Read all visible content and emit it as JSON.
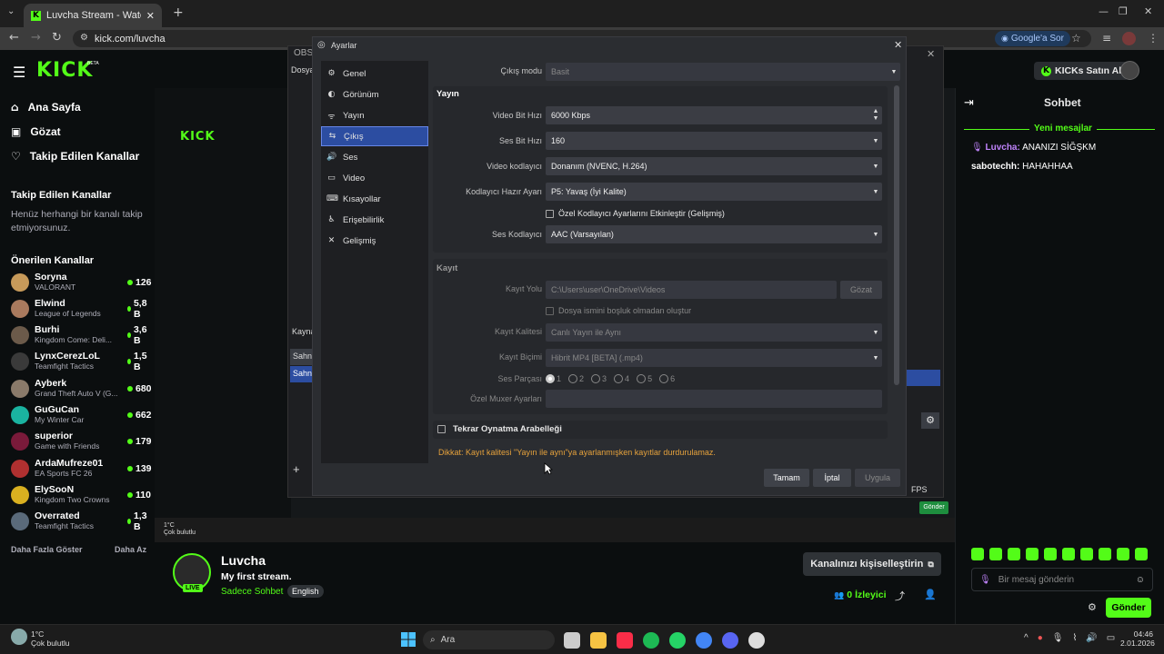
{
  "browser": {
    "tab_title": "Luvcha Stream - Watch Live",
    "url": "kick.com/luvcha",
    "google_button": "Google'a Sor"
  },
  "site": {
    "nav": [
      {
        "label": "Ana Sayfa",
        "icon": "home-icon"
      },
      {
        "label": "Gözat",
        "icon": "browse-icon"
      },
      {
        "label": "Takip Edilen Kanallar",
        "icon": "heart-icon"
      }
    ],
    "followed_heading": "Takip Edilen Kanallar",
    "followed_empty": "Henüz herhangi bir kanalı takip etmiyorsunuz.",
    "suggested_heading": "Önerilen Kanallar",
    "channels": [
      {
        "name": "Soryna",
        "game": "VALORANT",
        "viewers": "126",
        "color": "#c79a5a"
      },
      {
        "name": "Elwind",
        "game": "League of Legends",
        "viewers": "5,8 B",
        "color": "#a97a5e"
      },
      {
        "name": "Burhi",
        "game": "Kingdom Come: Deli...",
        "viewers": "3,6 B",
        "color": "#6b5a4a"
      },
      {
        "name": "LynxCerezLoL",
        "game": "Teamfight Tactics",
        "viewers": "1,5 B",
        "color": "#3a3a3a"
      },
      {
        "name": "Ayberk",
        "game": "Grand Theft Auto V (G...",
        "viewers": "680",
        "color": "#8a7a6a"
      },
      {
        "name": "GuGuCan",
        "game": "My Winter Car",
        "viewers": "662",
        "color": "#1ab3a0"
      },
      {
        "name": "superior",
        "game": "Game with Friends",
        "viewers": "179",
        "color": "#7a1a3a"
      },
      {
        "name": "ArdaMufreze01",
        "game": "EA Sports FC 26",
        "viewers": "139",
        "color": "#b03030"
      },
      {
        "name": "ElySooN",
        "game": "Kingdom Two Crowns",
        "viewers": "110",
        "color": "#d9b020"
      },
      {
        "name": "Overrated",
        "game": "Teamfight Tactics",
        "viewers": "1,3 B",
        "color": "#5a6a7a"
      }
    ],
    "show_more": "Daha Fazla Göster",
    "show_less": "Daha Az",
    "buy_kicks": "KICKs Satın Al",
    "streamer": {
      "name": "Luvcha",
      "title": "My first stream.",
      "category": "Sadece Sohbet",
      "language": "English",
      "live_badge": "LIVE",
      "customize_button": "Kanalınızı kişiselleştirin",
      "viewer_count": "0",
      "viewer_label": "İzleyici"
    },
    "chat": {
      "title": "Sohbet",
      "new_messages": "Yeni mesajlar",
      "messages": [
        {
          "user": "Luvcha:",
          "text": "ANANIZI SİĞŞKM"
        },
        {
          "user": "sabotechh:",
          "text": "HAHAHHAA"
        }
      ],
      "input_placeholder": "Bir mesaj gönderin",
      "send_button": "Gönder"
    }
  },
  "obs": {
    "main_title": "OBS",
    "menu_file": "Dosya",
    "left_labels": [
      "Kayna",
      "Sahne",
      "Sahne"
    ],
    "fps": "FPS",
    "send": "Gönder"
  },
  "settings": {
    "title": "Ayarlar",
    "sidebar": [
      {
        "label": "Genel",
        "icon": "gear-icon"
      },
      {
        "label": "Görünüm",
        "icon": "appearance-icon"
      },
      {
        "label": "Yayın",
        "icon": "antenna-icon"
      },
      {
        "label": "Çıkış",
        "icon": "output-icon",
        "active": true
      },
      {
        "label": "Ses",
        "icon": "speaker-icon"
      },
      {
        "label": "Video",
        "icon": "monitor-icon"
      },
      {
        "label": "Kısayollar",
        "icon": "keyboard-icon"
      },
      {
        "label": "Erişebilirlik",
        "icon": "accessibility-icon"
      },
      {
        "label": "Gelişmiş",
        "icon": "tools-icon"
      }
    ],
    "output_mode_label": "Çıkış modu",
    "output_mode_value": "Basit",
    "stream_section": "Yayın",
    "video_bitrate_label": "Video Bit Hızı",
    "video_bitrate_value": "6000 Kbps",
    "audio_bitrate_label": "Ses Bit Hızı",
    "audio_bitrate_value": "160",
    "video_encoder_label": "Video kodlayıcı",
    "video_encoder_value": "Donanım (NVENC, H.264)",
    "encoder_preset_label": "Kodlayıcı Hazır Ayarı",
    "encoder_preset_value": "P5: Yavaş (İyi Kalite)",
    "custom_encoder_checkbox": "Özel Kodlayıcı Ayarlarını Etkinleştir (Gelişmiş)",
    "audio_encoder_label": "Ses Kodlayıcı",
    "audio_encoder_value": "AAC (Varsayılan)",
    "recording_section": "Kayıt",
    "record_path_label": "Kayıt Yolu",
    "record_path_value": "C:\\Users\\user\\OneDrive\\Videos",
    "browse_button": "Gözat",
    "no_space_checkbox": "Dosya ismini boşluk olmadan oluştur",
    "record_quality_label": "Kayıt Kalitesi",
    "record_quality_value": "Canlı Yayın ile Aynı",
    "record_format_label": "Kayıt Biçimi",
    "record_format_value": "Hibrit MP4 [BETA] (.mp4)",
    "audio_track_label": "Ses Parçası",
    "audio_tracks": [
      "1",
      "2",
      "3",
      "4",
      "5",
      "6"
    ],
    "muxer_label": "Özel Muxer Ayarları",
    "replay_buffer_label": "Tekrar Oynatma Arabelleği",
    "warning": "Dikkat: Kayıt kalitesi \"Yayın ile aynı\"ya ayarlanmışken kayıtlar durdurulamaz.",
    "ok_button": "Tamam",
    "cancel_button": "İptal",
    "apply_button": "Uygula"
  },
  "taskbar": {
    "weather_temp": "1°C",
    "weather_text": "Çok bulutlu",
    "search_placeholder": "Ara",
    "time": "04:46",
    "date": "2.01.2026"
  },
  "colors": {
    "accent": "#53fc18",
    "selection": "#2c4da1",
    "warning": "#e6a23c"
  }
}
